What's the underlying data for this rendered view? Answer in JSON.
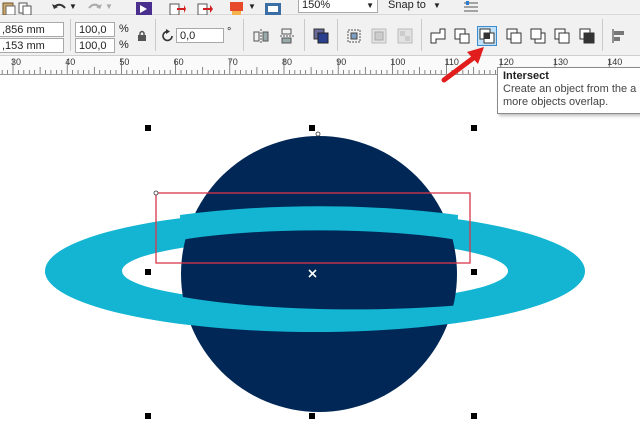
{
  "toolbar": {
    "zoom_value": "150%",
    "snap_label": "Snap to"
  },
  "property_bar": {
    "width_value": ",856 mm",
    "height_value": ",153 mm",
    "scale_x": "100,0",
    "scale_y": "100,0",
    "percent_symbol": "%",
    "rotation": "0,0",
    "rotation_unit": "°"
  },
  "ruler": {
    "ticks": [
      "30",
      "40",
      "50",
      "60",
      "70",
      "80",
      "90",
      "100",
      "110",
      "120",
      "130",
      "140"
    ]
  },
  "tooltip": {
    "title": "Intersect",
    "desc_line1": "Create an object from the a",
    "desc_line2": "more objects overlap."
  },
  "colors": {
    "planet_fill": "#002755",
    "ring_fill": "#13b5d3",
    "highlight_box": "#d9374a",
    "arrow": "#e11d1d",
    "active_button_bg": "#bfe0f7",
    "active_button_border": "#3c8dd0"
  },
  "icons": {
    "toolbar": [
      "paste-icon",
      "undo-icon",
      "redo-icon",
      "launcher-icon",
      "import-icon",
      "export-icon",
      "publish-pdf-icon",
      "app-launcher-icon",
      "snap-options-icon"
    ],
    "property_bar": [
      "lock-ratio-icon",
      "rotation-icon",
      "mirror-horizontal-icon",
      "mirror-vertical-icon",
      "to-front-icon",
      "group-icon",
      "ungroup-icon",
      "ungroup-all-icon",
      "weld-icon",
      "trim-icon",
      "intersect-icon",
      "simplify-icon",
      "front-minus-back-icon",
      "back-minus-front-icon",
      "create-boundary-icon",
      "align-icon"
    ]
  }
}
